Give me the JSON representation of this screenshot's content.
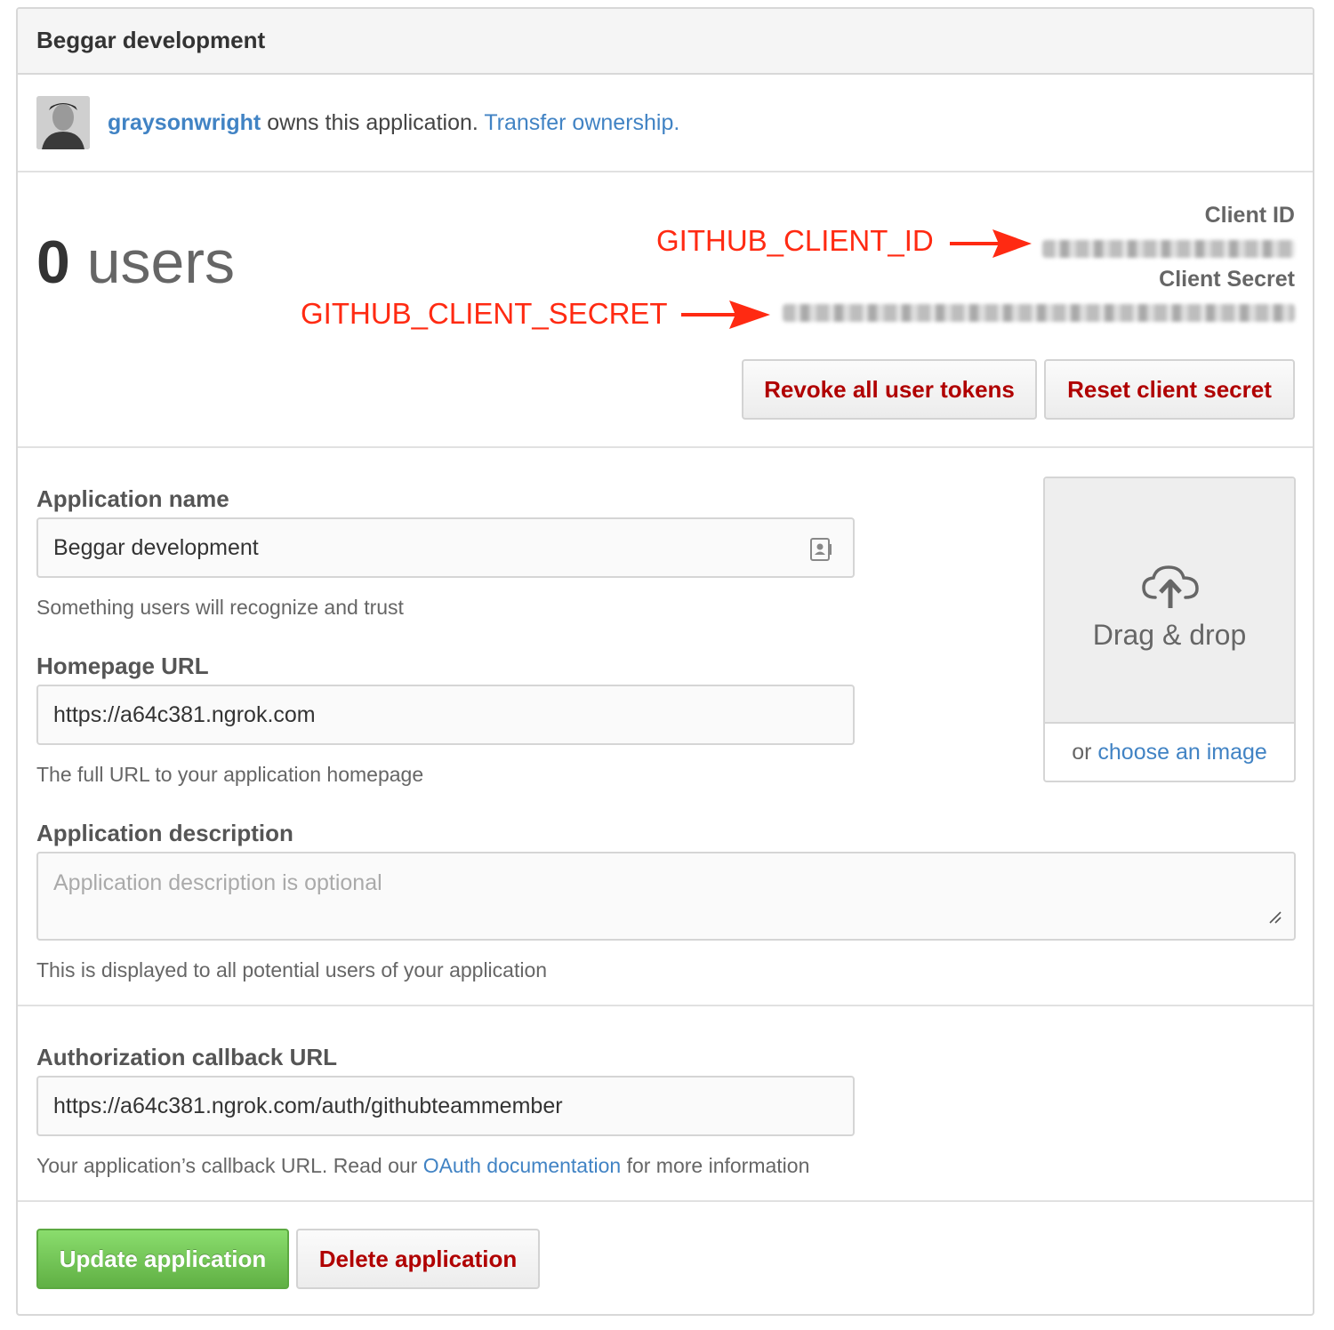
{
  "app": {
    "title": "Beggar development"
  },
  "owner": {
    "name": "graysonwright",
    "owns_text": " owns this application. ",
    "transfer_link": "Transfer ownership."
  },
  "stats": {
    "user_count": "0",
    "users_word": "users",
    "client_id_label": "Client ID",
    "client_secret_label": "Client Secret",
    "revoke_button": "Revoke all user tokens",
    "reset_button": "Reset client secret"
  },
  "annotations": {
    "client_id": "GITHUB_CLIENT_ID",
    "client_secret": "GITHUB_CLIENT_SECRET",
    "color": "#ff2a12"
  },
  "form": {
    "app_name": {
      "label": "Application name",
      "value": "Beggar development",
      "note": "Something users will recognize and trust"
    },
    "homepage": {
      "label": "Homepage URL",
      "value": "https://a64c381.ngrok.com",
      "note": "The full URL to your application homepage"
    },
    "description": {
      "label": "Application description",
      "placeholder": "Application description is optional",
      "note": "This is displayed to all potential users of your application"
    },
    "callback": {
      "label": "Authorization callback URL",
      "value": "https://a64c381.ngrok.com/auth/githubteammember",
      "note_before": "Your application’s callback URL. Read our ",
      "note_link": "OAuth documentation",
      "note_after": " for more information"
    }
  },
  "logo_upload": {
    "drop_text": "Drag & drop",
    "or_text": "or ",
    "choose_link": "choose an image"
  },
  "actions": {
    "update_button": "Update application",
    "delete_button": "Delete application"
  },
  "colors": {
    "link": "#4183c4",
    "danger": "#b00000",
    "primary": "#60b044",
    "border": "#d8d8d8"
  },
  "icons": [
    "contact-card-icon",
    "cloud-upload-icon",
    "resize-handle-icon",
    "arrow-icon"
  ]
}
